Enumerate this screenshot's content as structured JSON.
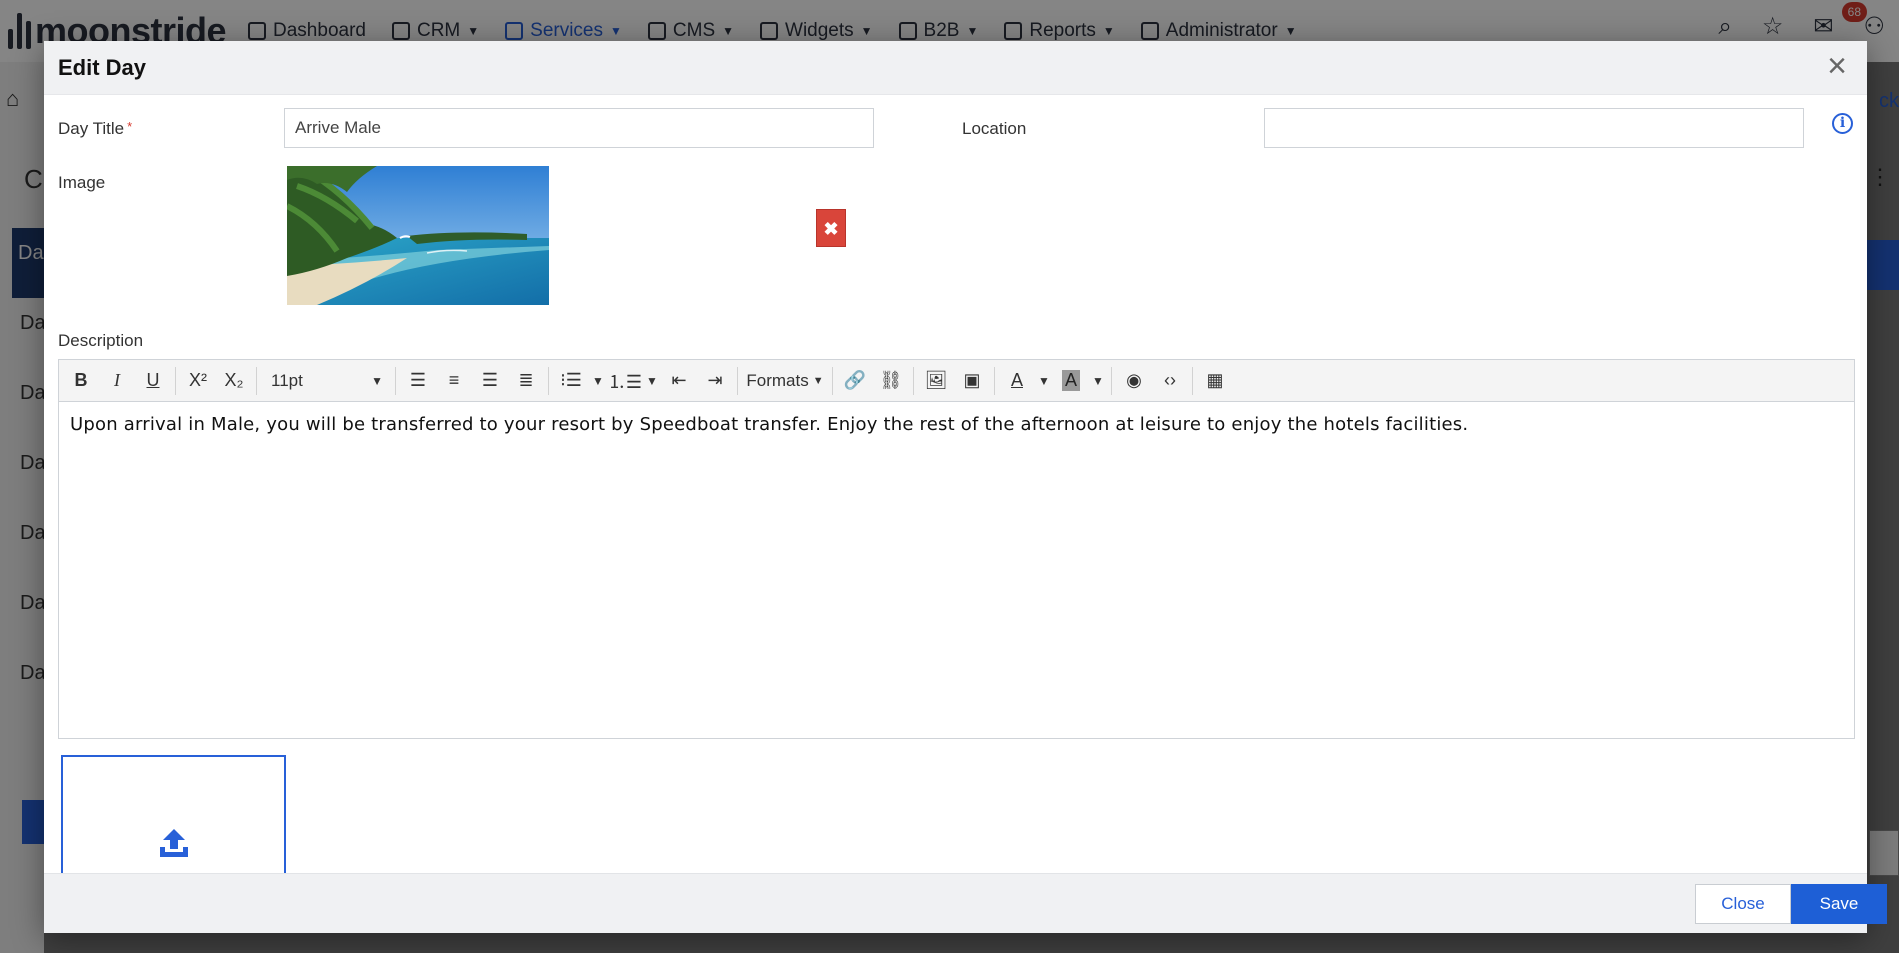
{
  "app": {
    "logo_text": "moonstride",
    "nav": [
      {
        "label": "Dashboard",
        "icon": "grid-icon",
        "has_caret": false
      },
      {
        "label": "CRM",
        "icon": "document-icon",
        "has_caret": true
      },
      {
        "label": "Services",
        "icon": "services-icon",
        "has_caret": true,
        "active": true
      },
      {
        "label": "CMS",
        "icon": "clipboard-icon",
        "has_caret": true
      },
      {
        "label": "Widgets",
        "icon": "puzzle-icon",
        "has_caret": true
      },
      {
        "label": "B2B",
        "icon": "b2b-icon",
        "has_caret": true
      },
      {
        "label": "Reports",
        "icon": "chart-icon",
        "has_caret": true
      },
      {
        "label": "Administrator",
        "icon": "wrench-icon",
        "has_caret": true
      }
    ],
    "notification_count": "68",
    "bg_side_letters": [
      "C",
      "Da",
      "Da",
      "Da",
      "Da",
      "Da",
      "Da",
      "Da"
    ],
    "bg_right_text": "ck"
  },
  "modal": {
    "title": "Edit Day",
    "fields": {
      "day_title_label": "Day Title",
      "day_title_required": "*",
      "day_title_value": "Arrive Male",
      "location_label": "Location",
      "location_value": "",
      "image_label": "Image",
      "description_label": "Description"
    },
    "editor": {
      "font_size": "11pt",
      "formats_label": "Formats",
      "content": "Upon arrival in Male, you will be transferred to your resort by Speedboat transfer. Enjoy the rest of the afternoon at leisure to enjoy the hotels facilities."
    },
    "footer": {
      "close_label": "Close",
      "save_label": "Save"
    }
  },
  "colors": {
    "accent": "#1e5fd6",
    "danger": "#d9453a",
    "required": "#d63a2f"
  }
}
